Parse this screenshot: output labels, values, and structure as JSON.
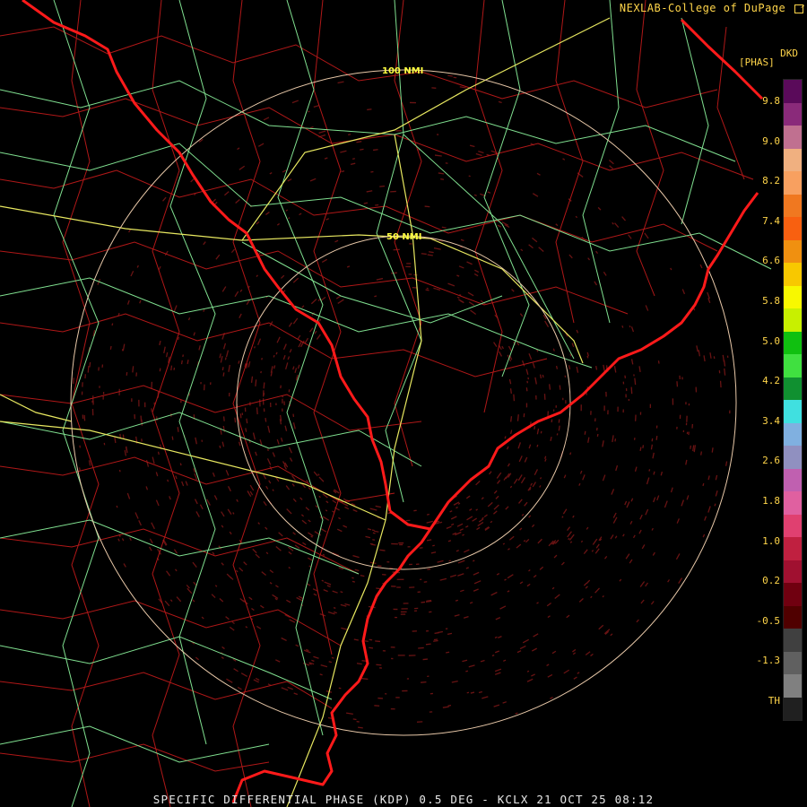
{
  "credit": "NEXLAB-College of DuPage",
  "credit_icon": "external-link-icon",
  "footer_caption": "SPECIFIC DIFFERENTIAL PHASE (KDP) 0.5 DEG - KCLX 21 OCT 25 08:12",
  "range_rings": {
    "inner_label": "50 NMI",
    "outer_label": "100 NMI"
  },
  "legend": {
    "product_code": "DKD",
    "units": "[PHAS]",
    "ticks": [
      "9.8",
      "9.0",
      "8.2",
      "7.4",
      "6.6",
      "5.8",
      "5.0",
      "4.2",
      "3.4",
      "2.6",
      "1.8",
      "1.0",
      "0.2",
      "-0.5",
      "-1.3",
      "TH"
    ],
    "colors": [
      "#5a0a5a",
      "#8a2a7a",
      "#c07090",
      "#f0b080",
      "#f8a060",
      "#f07820",
      "#f86010",
      "#f09010",
      "#f8c800",
      "#f8f800",
      "#c8f000",
      "#10c010",
      "#40e040",
      "#109030",
      "#40e0e0",
      "#80b0e0",
      "#9090c0",
      "#c060b0",
      "#e060a0",
      "#e04070",
      "#c02040",
      "#a01030",
      "#700010",
      "#500000",
      "#404040",
      "#606060",
      "#808080",
      "#202020"
    ]
  },
  "map_colors": {
    "background": "#000000",
    "state_border": "#ff1a1a",
    "county_lines": "#b01818",
    "highways": "#80e090",
    "interstates": "#e8e860",
    "range_rings": "#e8c8a8",
    "kdp_noise": "#8b1a1a"
  }
}
